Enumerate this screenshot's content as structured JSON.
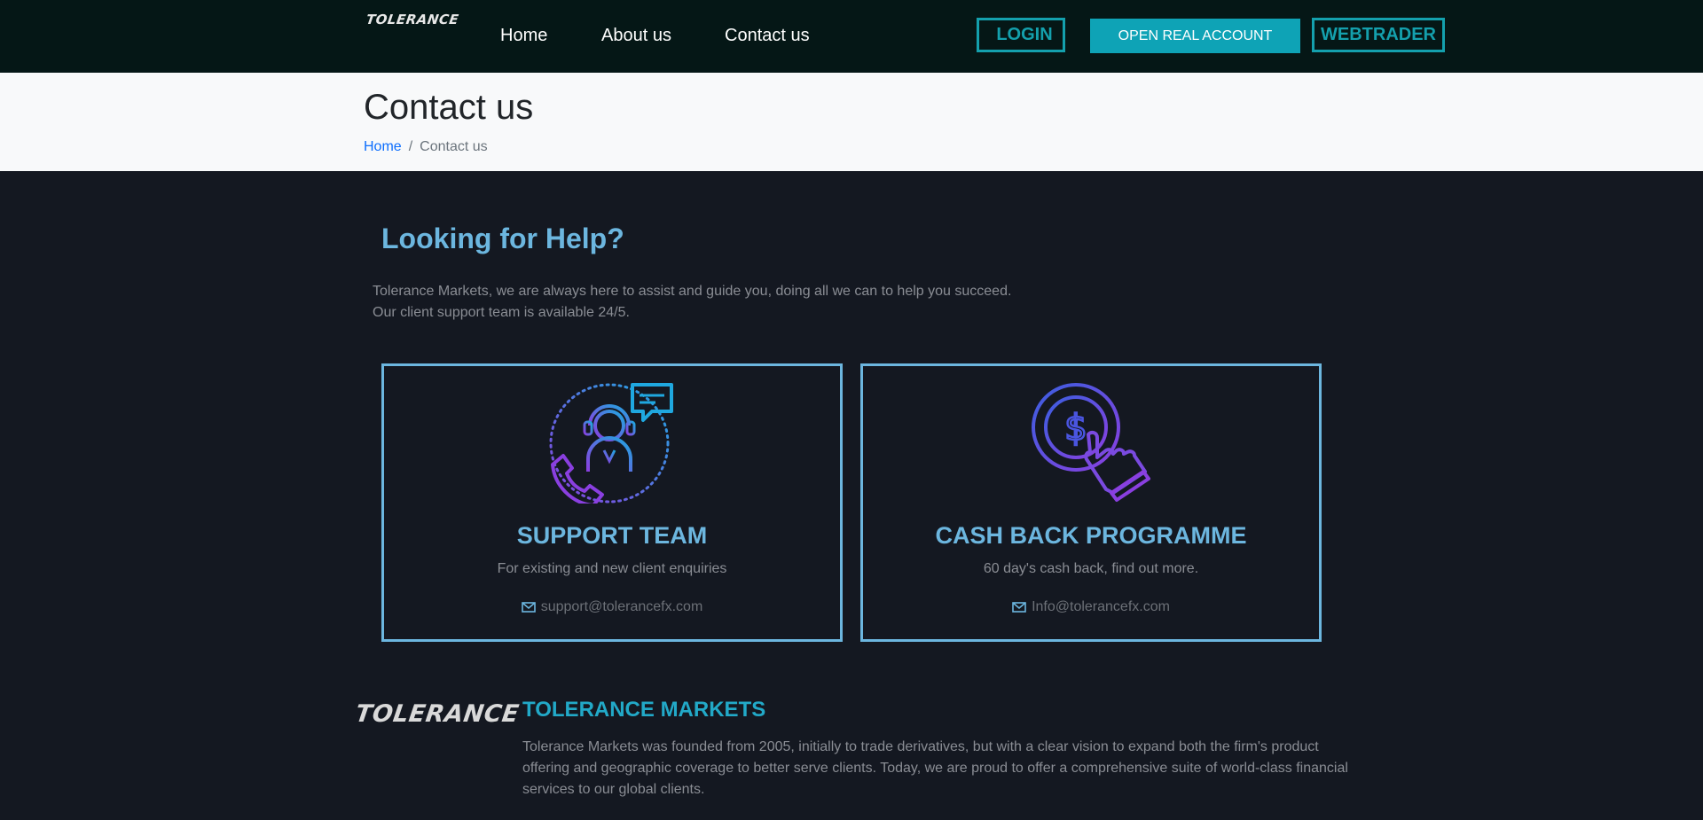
{
  "header": {
    "logo_text": "TOLERANCE",
    "nav": [
      {
        "label": "Home"
      },
      {
        "label": "About us"
      },
      {
        "label": "Contact us"
      }
    ],
    "login_label": "LOGIN",
    "open_account_label": "OPEN REAL ACCOUNT",
    "webtrader_label": "WEBTRADER"
  },
  "page_title": "Contact us",
  "breadcrumb": {
    "home": "Home",
    "separator": "/",
    "current": "Contact us"
  },
  "help": {
    "title": "Looking for Help?",
    "line1": "Tolerance Markets, we are always here to assist and guide you, doing all we can to help you succeed.",
    "line2": "Our client support team is available 24/5."
  },
  "cards": [
    {
      "icon": "support-agent-icon",
      "title": "SUPPORT TEAM",
      "subtitle": "For existing and new client enquiries",
      "email": "support@tolerancefx.com"
    },
    {
      "icon": "cashback-icon",
      "title": "CASH BACK PROGRAMME",
      "subtitle": "60 day's cash back, find out more.",
      "email": "Info@tolerancefx.com"
    }
  ],
  "about": {
    "logo_text": "TOLERANCE",
    "title": "TOLERANCE MARKETS",
    "text": "Tolerance Markets was founded from 2005, initially to trade derivatives, but with a clear vision to expand both the firm's product offering and geographic coverage to better serve clients. Today, we are proud to offer a comprehensive suite of world-class financial services to our global clients."
  },
  "colors": {
    "header_bg": "#051716",
    "accent_teal": "#0ea3b6",
    "card_border": "#6cb6df",
    "page_bg": "#141821"
  }
}
